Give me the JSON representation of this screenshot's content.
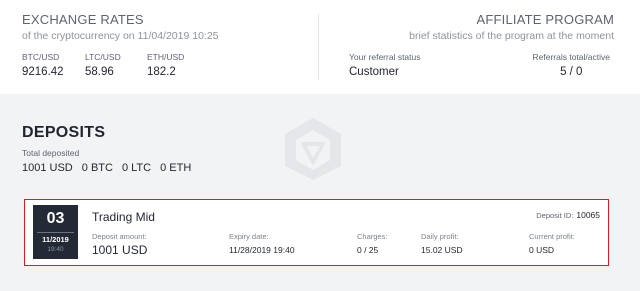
{
  "exchange": {
    "title": "EXCHANGE RATES",
    "subtitle": "of the cryptocurrency on 11/04/2019 10:25",
    "rates": [
      {
        "label": "BTC/USD",
        "value": "9216.42"
      },
      {
        "label": "LTC/USD",
        "value": "58.96"
      },
      {
        "label": "ETH/USD",
        "value": "182.2"
      }
    ]
  },
  "affiliate": {
    "title": "AFFILIATE PROGRAM",
    "subtitle": "brief statistics of the program at the moment",
    "status_label": "Your referral status",
    "status_value": "Customer",
    "total_label": "Referrals total/active",
    "total_value": "5 / 0"
  },
  "deposits": {
    "title": "DEPOSITS",
    "total_label": "Total deposited",
    "totals": [
      "1001 USD",
      "0 BTC",
      "0 LTC",
      "0 ETH"
    ],
    "card": {
      "day": "03",
      "month_year": "11/2019",
      "time": "19:40",
      "plan": "Trading Mid",
      "deposit_id_label": "Deposit ID:",
      "deposit_id": "10065",
      "amount_label": "Deposit amount:",
      "amount": "1001 USD",
      "expiry_label": "Expiry date:",
      "expiry": "11/28/2019 19:40",
      "charges_label": "Charges:",
      "charges": "0 / 25",
      "daily_label": "Daily profit:",
      "daily": "15.02 USD",
      "current_label": "Current profit:",
      "current": "0 USD"
    }
  },
  "colors": {
    "highlight_border": "#e0191e",
    "date_box": "#232a36"
  }
}
